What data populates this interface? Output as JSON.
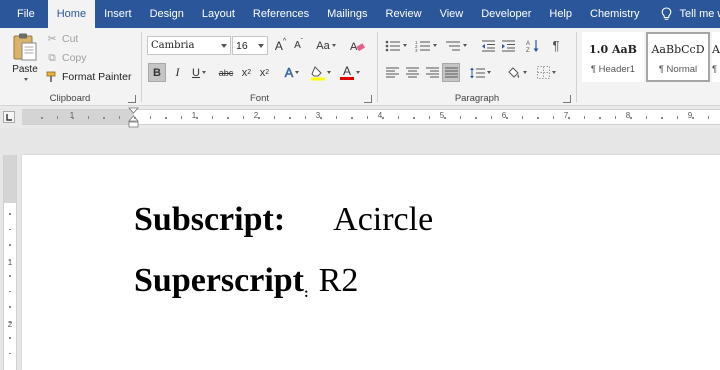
{
  "menu": {
    "tabs": [
      "File",
      "Home",
      "Insert",
      "Design",
      "Layout",
      "References",
      "Mailings",
      "Review",
      "View",
      "Developer",
      "Help",
      "Chemistry"
    ],
    "active_tab": "Home",
    "tell_me": "Tell me wha"
  },
  "clipboard": {
    "paste_label": "Paste",
    "cut_label": "Cut",
    "copy_label": "Copy",
    "format_painter_label": "Format Painter",
    "group_label": "Clipboard"
  },
  "font": {
    "font_name": "Cambria",
    "font_size": "16",
    "grow_label": "A",
    "shrink_label": "A",
    "case_label": "Aa",
    "bold_label": "B",
    "italic_label": "I",
    "underline_label": "U",
    "strike_label": "abc",
    "subscript_label": "x",
    "subscript_sub": "2",
    "superscript_label": "x",
    "superscript_sup": "2",
    "text_effects_label": "A",
    "font_color_label": "A",
    "highlight_color": "#ffff00",
    "font_color": "#e00000",
    "group_label": "Font"
  },
  "paragraph": {
    "group_label": "Paragraph"
  },
  "styles": {
    "items": [
      {
        "sample": "1.0  AaB",
        "name": "¶ Header1"
      },
      {
        "sample": "AaBbCcD",
        "name": "¶ Normal"
      },
      {
        "sample": "A",
        "name": "¶"
      }
    ]
  },
  "ruler": {
    "numbers": [
      "1",
      "1",
      "2",
      "3",
      "4",
      "5",
      "6",
      "7",
      "8",
      "9"
    ],
    "vnumbers": [
      "1",
      "2"
    ]
  },
  "document": {
    "line1_label": "Subscript:",
    "line1_value": "Acircle",
    "line2_label": "Superscript",
    "line2_colon": ":",
    "line2_value": "R2"
  },
  "colors": {
    "accent": "#2b579a",
    "ribbon": "#f3f3f3"
  }
}
